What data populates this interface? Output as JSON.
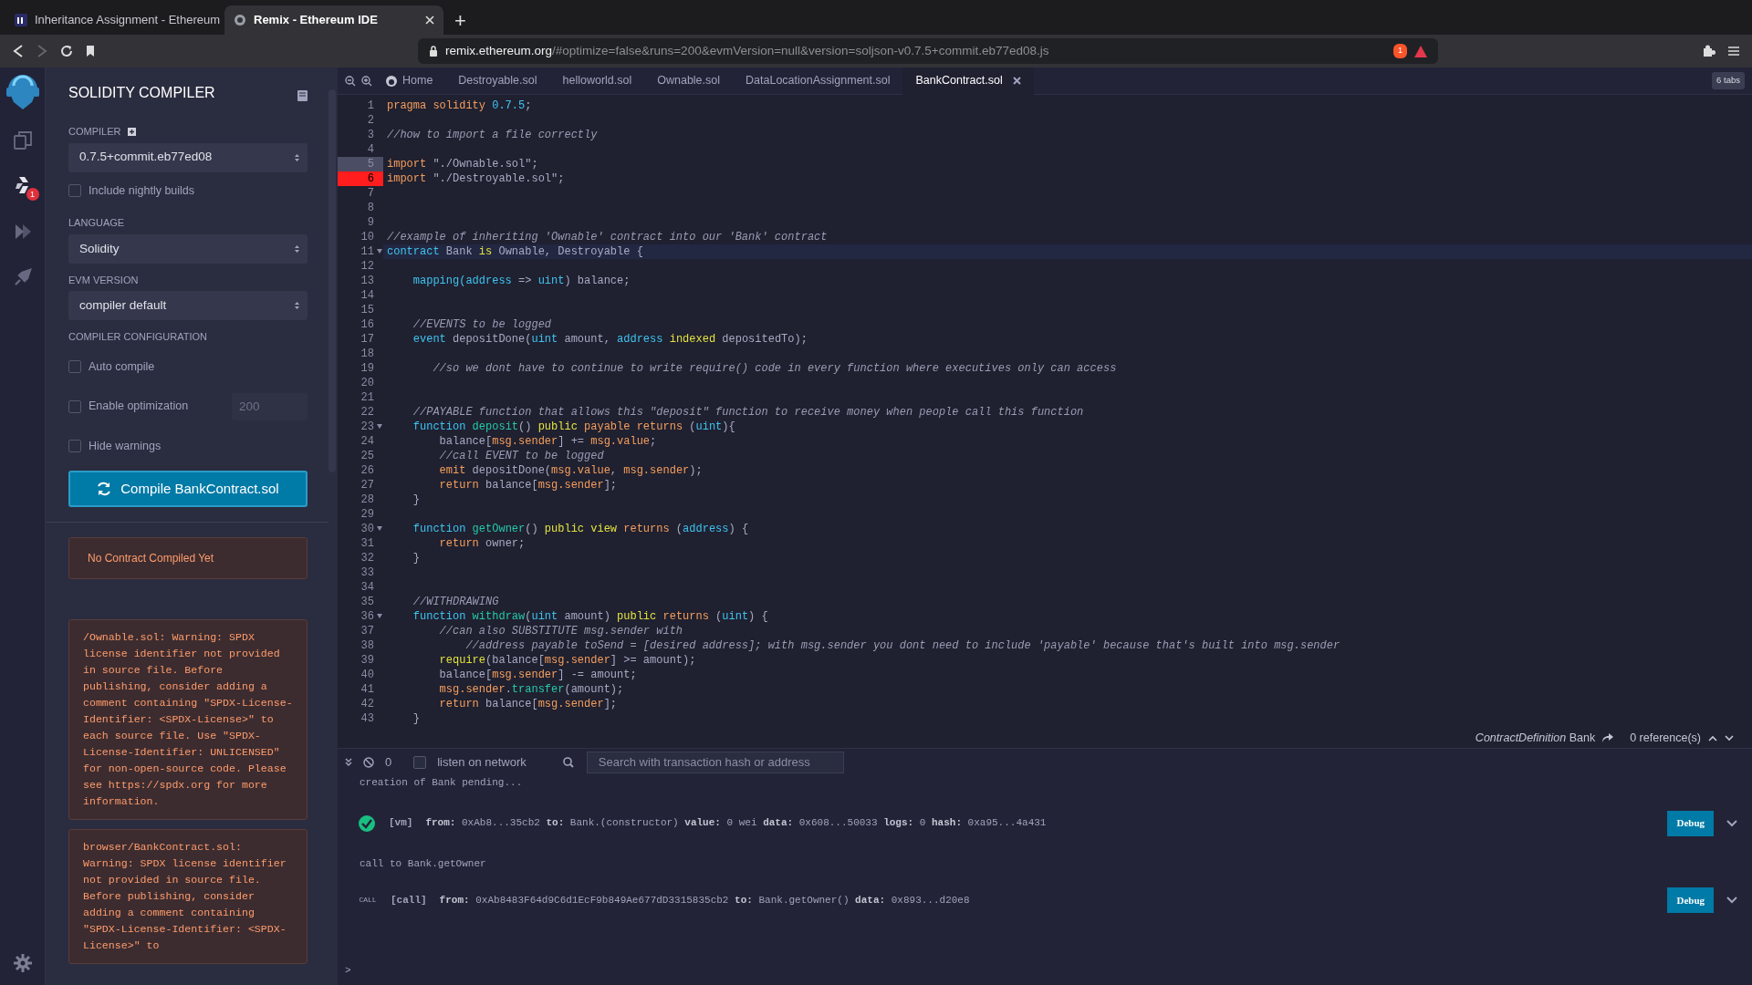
{
  "browser": {
    "tabs": [
      {
        "title": "Inheritance Assignment - Ethereum",
        "kind": "udemy",
        "selected": false
      },
      {
        "title": "Remix - Ethereum IDE",
        "kind": "remix",
        "selected": true
      }
    ],
    "new_tab": "+",
    "address": {
      "host": "remix.ethereum.org",
      "path": "/#optimize=false&runs=200&evmVersion=null&version=soljson-v0.7.5+commit.eb77ed08.js"
    },
    "shield_count": "1"
  },
  "icon_rail": {
    "items": [
      {
        "kind": "files",
        "selected": false
      },
      {
        "kind": "compiler",
        "selected": true,
        "badge": "1"
      },
      {
        "kind": "deploy",
        "selected": false
      },
      {
        "kind": "plugins",
        "selected": false
      }
    ]
  },
  "compiler_panel": {
    "title": "SOLIDITY COMPILER",
    "compiler_label": "COMPILER",
    "compiler_version": "0.7.5+commit.eb77ed08",
    "options": [
      {
        "kind": "checkbox",
        "label": "Include nightly builds",
        "checked": false
      },
      {
        "kind": "heading",
        "label": "LANGUAGE"
      },
      {
        "kind": "select",
        "value": "Solidity"
      },
      {
        "kind": "heading",
        "label": "EVM VERSION"
      },
      {
        "kind": "select",
        "value": "compiler default"
      },
      {
        "kind": "heading",
        "label": "COMPILER CONFIGURATION"
      },
      {
        "kind": "checkbox",
        "label": "Auto compile",
        "checked": false
      },
      {
        "kind": "checkbox",
        "label": "Enable optimization",
        "checked": false,
        "runs": "200",
        "runs_disabled": true
      },
      {
        "kind": "checkbox",
        "label": "Hide warnings",
        "checked": false
      }
    ],
    "compile_button": "Compile BankContract.sol",
    "status": "No Contract Compiled Yet",
    "warnings": [
      "/Ownable.sol: Warning: SPDX license identifier not provided in source file. Before publishing, consider adding a comment containing \"SPDX-License-Identifier: <SPDX-License>\" to each source file. Use \"SPDX-License-Identifier: UNLICENSED\" for non-open-source code. Please see https://spdx.org for more information.",
      "browser/BankContract.sol: Warning: SPDX license identifier not provided in source file. Before publishing, consider adding a comment containing \"SPDX-License-Identifier: <SPDX-License>\" to"
    ]
  },
  "editor": {
    "tabs": [
      {
        "label": "Home",
        "kind": "home",
        "selected": false
      },
      {
        "label": "Destroyable.sol",
        "kind": "file",
        "selected": false
      },
      {
        "label": "helloworld.sol",
        "kind": "file",
        "selected": false
      },
      {
        "label": "Ownable.sol",
        "kind": "file",
        "selected": false
      },
      {
        "label": "DataLocationAssignment.sol",
        "kind": "file",
        "selected": false
      },
      {
        "label": "BankContract.sol",
        "kind": "file",
        "selected": true
      }
    ],
    "tab_count": "6 tabs",
    "lines": [
      {
        "number": "1",
        "segments": [
          {
            "text": "pragma solidity ",
            "kind": "kw"
          },
          {
            "text": "0.7.5",
            "kind": "num"
          },
          {
            "text": ";",
            "kind": "plain"
          }
        ]
      },
      {
        "number": "2"
      },
      {
        "number": "3",
        "segments": [
          {
            "text": "//how to import a file correctly",
            "kind": "com"
          }
        ]
      },
      {
        "number": "4"
      },
      {
        "number": "5",
        "highlighted": true,
        "segments": [
          {
            "text": "import",
            "kind": "kw"
          },
          {
            "text": " \"./Ownable.sol\";",
            "kind": "plain"
          }
        ]
      },
      {
        "number": "6",
        "error": true,
        "segments": [
          {
            "text": "import",
            "kind": "kw"
          },
          {
            "text": " \"./Destroyable.sol\";",
            "kind": "plain"
          }
        ]
      },
      {
        "number": "7"
      },
      {
        "number": "8"
      },
      {
        "number": "9"
      },
      {
        "number": "10",
        "segments": [
          {
            "text": "//example of inheriting 'Ownable' contract into our 'Bank' contract",
            "kind": "com"
          }
        ]
      },
      {
        "number": "11",
        "foldable": true,
        "active": true,
        "segments": [
          {
            "text": "contract",
            "kind": "type"
          },
          {
            "text": " Bank ",
            "kind": "plain"
          },
          {
            "text": "is",
            "kind": "mod"
          },
          {
            "text": " Ownable, Destroyable {",
            "kind": "plain"
          }
        ]
      },
      {
        "number": "12"
      },
      {
        "number": "13",
        "segments": [
          {
            "text": "    mapping(address",
            "kind": "type"
          },
          {
            "text": " => ",
            "kind": "plain"
          },
          {
            "text": "uint",
            "kind": "type"
          },
          {
            "text": ") balance;",
            "kind": "plain"
          }
        ]
      },
      {
        "number": "14"
      },
      {
        "number": "15"
      },
      {
        "number": "16",
        "segments": [
          {
            "text": "    //EVENTS to be logged",
            "kind": "com"
          }
        ]
      },
      {
        "number": "17",
        "segments": [
          {
            "text": "    event",
            "kind": "type"
          },
          {
            "text": " depositDone(",
            "kind": "plain"
          },
          {
            "text": "uint",
            "kind": "type"
          },
          {
            "text": " amount, ",
            "kind": "plain"
          },
          {
            "text": "address",
            "kind": "type"
          },
          {
            "text": " indexed",
            "kind": "mod"
          },
          {
            "text": " depositedTo);",
            "kind": "plain"
          }
        ]
      },
      {
        "number": "18"
      },
      {
        "number": "19",
        "segments": [
          {
            "text": "       //so we dont have to continue to write require() code in every function where executives only can access",
            "kind": "com"
          }
        ]
      },
      {
        "number": "20"
      },
      {
        "number": "21"
      },
      {
        "number": "22",
        "segments": [
          {
            "text": "    //PAYABLE function that allows this \"deposit\" function to receive money when people call this function",
            "kind": "com"
          }
        ]
      },
      {
        "number": "23",
        "foldable": true,
        "segments": [
          {
            "text": "    function",
            "kind": "type"
          },
          {
            "text": " deposit",
            "kind": "fn"
          },
          {
            "text": "() ",
            "kind": "plain"
          },
          {
            "text": "public",
            "kind": "mod"
          },
          {
            "text": " payable returns",
            "kind": "kw"
          },
          {
            "text": " (",
            "kind": "plain"
          },
          {
            "text": "uint",
            "kind": "type"
          },
          {
            "text": "){",
            "kind": "plain"
          }
        ]
      },
      {
        "number": "24",
        "segments": [
          {
            "text": "        balance[",
            "kind": "plain"
          },
          {
            "text": "msg.sender",
            "kind": "kw"
          },
          {
            "text": "] += ",
            "kind": "plain"
          },
          {
            "text": "msg.value",
            "kind": "kw"
          },
          {
            "text": ";",
            "kind": "plain"
          }
        ]
      },
      {
        "number": "25",
        "segments": [
          {
            "text": "        //call EVENT to be logged",
            "kind": "com"
          }
        ]
      },
      {
        "number": "26",
        "segments": [
          {
            "text": "        emit",
            "kind": "kw"
          },
          {
            "text": " depositDone(",
            "kind": "plain"
          },
          {
            "text": "msg.value",
            "kind": "kw"
          },
          {
            "text": ", ",
            "kind": "plain"
          },
          {
            "text": "msg.sender",
            "kind": "kw"
          },
          {
            "text": ");",
            "kind": "plain"
          }
        ]
      },
      {
        "number": "27",
        "segments": [
          {
            "text": "        return",
            "kind": "kw"
          },
          {
            "text": " balance[",
            "kind": "plain"
          },
          {
            "text": "msg.sender",
            "kind": "kw"
          },
          {
            "text": "];",
            "kind": "plain"
          }
        ]
      },
      {
        "number": "28",
        "segments": [
          {
            "text": "    }",
            "kind": "plain"
          }
        ]
      },
      {
        "number": "29"
      },
      {
        "number": "30",
        "foldable": true,
        "segments": [
          {
            "text": "    function",
            "kind": "type"
          },
          {
            "text": " getOwner",
            "kind": "fn"
          },
          {
            "text": "() ",
            "kind": "plain"
          },
          {
            "text": "public view",
            "kind": "mod"
          },
          {
            "text": " returns",
            "kind": "kw"
          },
          {
            "text": " (",
            "kind": "plain"
          },
          {
            "text": "address",
            "kind": "type"
          },
          {
            "text": ") {",
            "kind": "plain"
          }
        ]
      },
      {
        "number": "31",
        "segments": [
          {
            "text": "        return",
            "kind": "kw"
          },
          {
            "text": " owner;",
            "kind": "plain"
          }
        ]
      },
      {
        "number": "32",
        "segments": [
          {
            "text": "    }",
            "kind": "plain"
          }
        ]
      },
      {
        "number": "33"
      },
      {
        "number": "34"
      },
      {
        "number": "35",
        "segments": [
          {
            "text": "    //WITHDRAWING",
            "kind": "com"
          }
        ]
      },
      {
        "number": "36",
        "foldable": true,
        "segments": [
          {
            "text": "    function",
            "kind": "type"
          },
          {
            "text": " withdraw",
            "kind": "fn"
          },
          {
            "text": "(",
            "kind": "plain"
          },
          {
            "text": "uint",
            "kind": "type"
          },
          {
            "text": " amount) ",
            "kind": "plain"
          },
          {
            "text": "public",
            "kind": "mod"
          },
          {
            "text": " returns",
            "kind": "kw"
          },
          {
            "text": " (",
            "kind": "plain"
          },
          {
            "text": "uint",
            "kind": "type"
          },
          {
            "text": ") {",
            "kind": "plain"
          }
        ]
      },
      {
        "number": "37",
        "segments": [
          {
            "text": "        //can also SUBSTITUTE msg.sender with",
            "kind": "com"
          }
        ]
      },
      {
        "number": "38",
        "segments": [
          {
            "text": "            //address payable toSend = [desired address]; with msg.sender you dont need to include 'payable' because that's built into msg.sender",
            "kind": "com"
          }
        ]
      },
      {
        "number": "39",
        "segments": [
          {
            "text": "        require",
            "kind": "mod"
          },
          {
            "text": "(balance[",
            "kind": "plain"
          },
          {
            "text": "msg.sender",
            "kind": "kw"
          },
          {
            "text": "] >= amount);",
            "kind": "plain"
          }
        ]
      },
      {
        "number": "40",
        "segments": [
          {
            "text": "        balance[",
            "kind": "plain"
          },
          {
            "text": "msg.sender",
            "kind": "kw"
          },
          {
            "text": "] -= amount;",
            "kind": "plain"
          }
        ]
      },
      {
        "number": "41",
        "segments": [
          {
            "text": "        msg.sender",
            "kind": "kw"
          },
          {
            "text": ".",
            "kind": "plain"
          },
          {
            "text": "transfer",
            "kind": "fn"
          },
          {
            "text": "(amount);",
            "kind": "plain"
          }
        ]
      },
      {
        "number": "42",
        "segments": [
          {
            "text": "        return",
            "kind": "kw"
          },
          {
            "text": " balance[",
            "kind": "plain"
          },
          {
            "text": "msg.sender",
            "kind": "kw"
          },
          {
            "text": "];",
            "kind": "plain"
          }
        ]
      },
      {
        "number": "43",
        "segments": [
          {
            "text": "    }",
            "kind": "plain"
          }
        ]
      }
    ]
  },
  "reference_bar": {
    "definition_kind": "ContractDefinition",
    "name": "Bank",
    "references": "0 reference(s)"
  },
  "terminal": {
    "pending_count": "0",
    "listen_label": "listen on network",
    "listen_checked": false,
    "search_placeholder": "Search with transaction hash or address",
    "entries": [
      {
        "kind": "text",
        "text": "creation of Bank pending..."
      },
      {
        "kind": "tx",
        "tag": "[vm]",
        "details": "**from:** 0xAb8...35cb2 **to:** Bank.(constructor) **value:** 0 wei **data:** 0x608...50033 **logs:** 0 **hash:** 0xa95...4a431",
        "button": "Debug"
      },
      {
        "kind": "text",
        "text": "call to Bank.getOwner"
      },
      {
        "kind": "call",
        "status_label": "CALL",
        "tag": "[call]",
        "details": "**from:** 0xAb8483F64d9C6d1EcF9b849Ae677dD3315835cb2 **to:** Bank.getOwner() **data:** 0x893...d20e8",
        "button": "Debug"
      }
    ],
    "prompt": ">"
  }
}
